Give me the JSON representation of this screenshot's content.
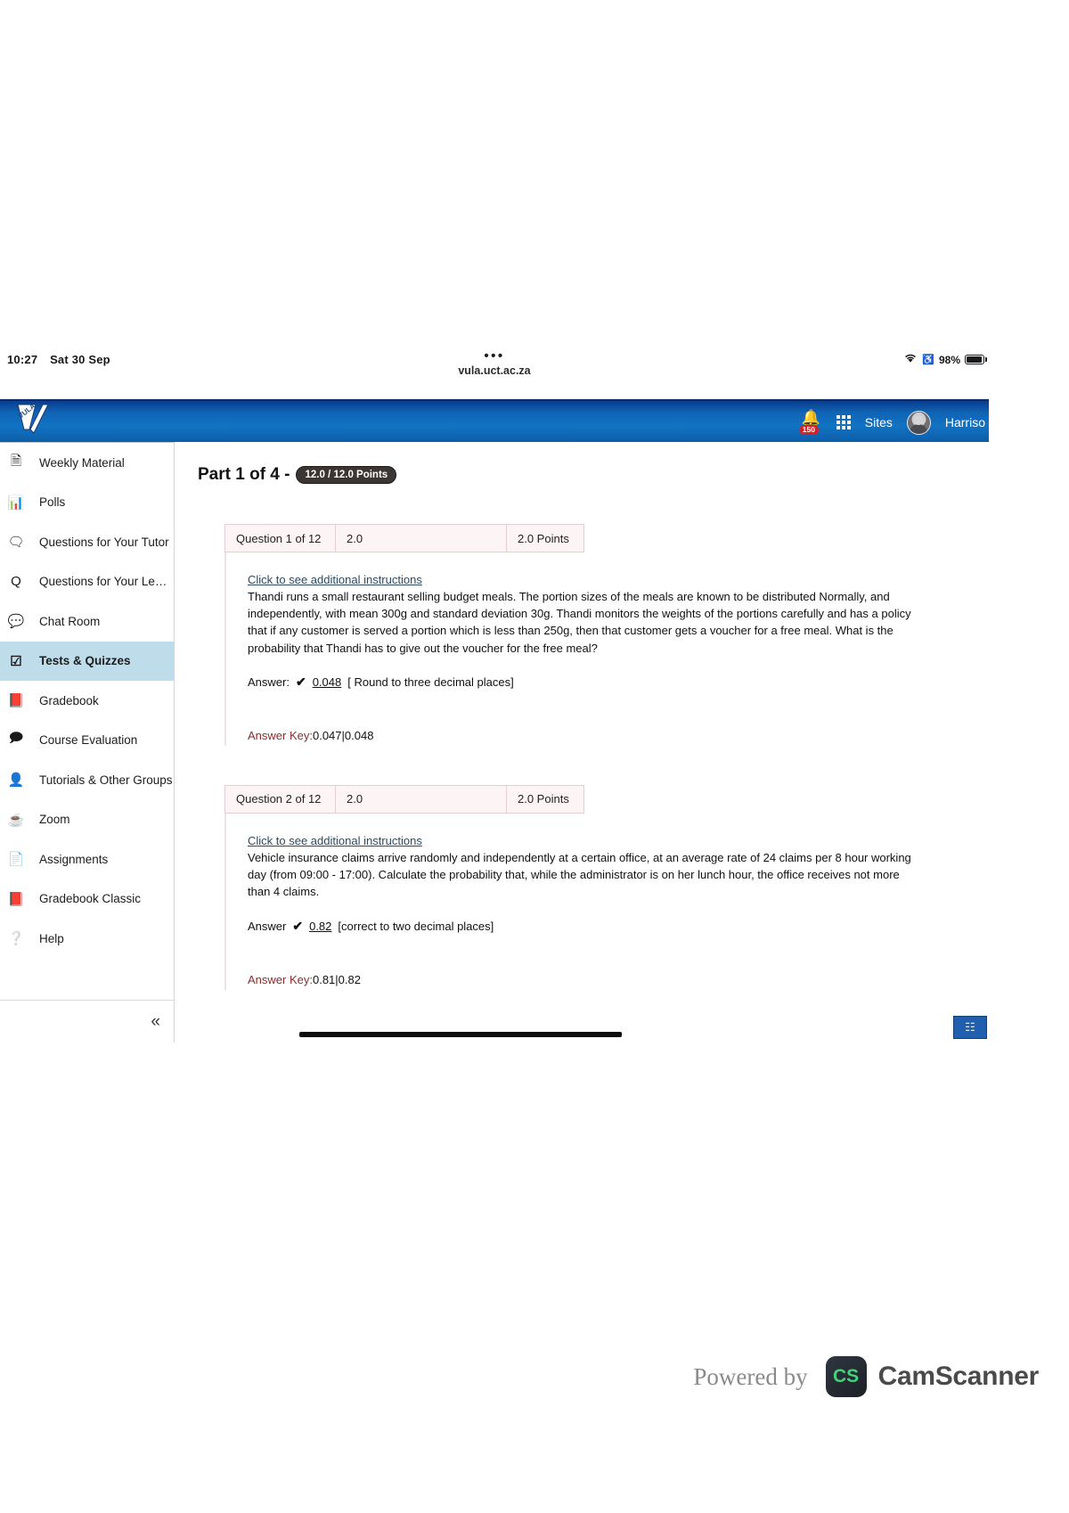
{
  "status_bar": {
    "time": "10:27",
    "date": "Sat 30 Sep",
    "tab_dots": "•••",
    "url": "vula.uct.ac.za",
    "wifi_icon": "wifi-icon",
    "lock_icon": "lock-icon",
    "battery_percent": "98%"
  },
  "topbar": {
    "logo_text": "VULA",
    "bell_icon": "bell-icon",
    "notification_count": "150",
    "grid_icon": "grid-icon",
    "sites_label": "Sites",
    "user_name": "Harriso",
    "drawer_toggle": "‹"
  },
  "sidebar": {
    "collapse_icon": "«",
    "items": [
      {
        "label": "Weekly Material",
        "icon": "document-icon",
        "active": false
      },
      {
        "label": "Polls",
        "icon": "bar-chart-icon",
        "active": false
      },
      {
        "label": "Questions for Your Tutor",
        "icon": "chat-bubbles-icon",
        "active": false
      },
      {
        "label": "Questions for Your Le…",
        "icon": "q-letter-icon",
        "active": false
      },
      {
        "label": "Chat Room",
        "icon": "chat-bubble-icon",
        "active": false
      },
      {
        "label": "Tests & Quizzes",
        "icon": "checkbox-icon",
        "active": true
      },
      {
        "label": "Gradebook",
        "icon": "book-icon",
        "active": false
      },
      {
        "label": "Course Evaluation",
        "icon": "speech-bubble-icon",
        "active": false
      },
      {
        "label": "Tutorials & Other Groups",
        "icon": "person-icon",
        "active": false
      },
      {
        "label": "Zoom",
        "icon": "cup-icon",
        "active": false
      },
      {
        "label": "Assignments",
        "icon": "file-icon",
        "active": false
      },
      {
        "label": "Gradebook Classic",
        "icon": "book-icon",
        "active": false
      },
      {
        "label": "Help",
        "icon": "question-circle-icon",
        "active": false
      }
    ]
  },
  "main": {
    "part_title": "Part 1 of 4 -",
    "part_points": "12.0 / 12.0 Points",
    "questions": [
      {
        "number_label": "Question 1 of 12",
        "score": "2.0",
        "points": "2.0 Points",
        "instructions_link": "Click to see additional instructions",
        "text": "Thandi runs a small restaurant selling budget meals. The portion sizes of the meals are known to be distributed Normally, and independently, with mean 300g and standard deviation 30g. Thandi monitors the weights of the portions carefully and has a policy that if any customer is served a portion which is less than 250g, then that customer gets a voucher for a free meal. What is the probability that Thandi has to give out the voucher for the free meal?",
        "answer_label": "Answer:",
        "tick_icon": "check-icon",
        "answer_value": "0.048",
        "answer_note": "[ Round to three decimal places]",
        "answer_key_label": "Answer Key:",
        "answer_key_value": "0.047|0.048"
      },
      {
        "number_label": "Question 2 of 12",
        "score": "2.0",
        "points": "2.0 Points",
        "instructions_link": "Click to see additional instructions",
        "text": "Vehicle insurance claims arrive randomly and independently at a certain office, at an average rate of 24 claims per 8 hour working day (from 09:00 - 17:00). Calculate the probability that, while the administrator is on her lunch hour, the office receives not more than 4 claims.",
        "answer_label": "Answer",
        "tick_icon": "check-icon",
        "answer_value": "0.82",
        "answer_note": "[correct to two decimal places]",
        "answer_key_label": "Answer Key:",
        "answer_key_value": "0.81|0.82"
      }
    ]
  },
  "watermark": {
    "powered_by": "Powered by",
    "logo_mark": "CS",
    "app_name": "CamScanner"
  }
}
